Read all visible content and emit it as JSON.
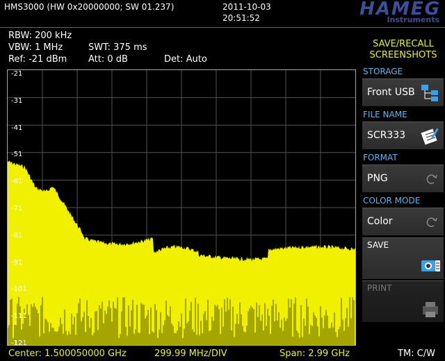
{
  "header": {
    "model": "HMS3000 (HW 0x20000000; SW 01.237)",
    "date": "2011-10-03",
    "time": "20:51:52",
    "logo_title": "HAMEG",
    "logo_sub": "Instruments"
  },
  "params": {
    "rbw": "RBW: 200 kHz",
    "vbw": "VBW: 1 MHz",
    "swt": "SWT: 375 ms",
    "ref": "Ref: -21 dBm",
    "att": "Att: 0 dB",
    "det": "Det: Auto"
  },
  "plot": {
    "y_labels": [
      "-21",
      "-31",
      "-41",
      "-51",
      "-61",
      "-71",
      "-81",
      "-91",
      "-101",
      "-111",
      "-121"
    ],
    "trace_color": "#f0f000",
    "grid_color": "#555555"
  },
  "footer": {
    "center": "Center: 1.500050000 GHz",
    "div": "299.99 MHz/DIV",
    "span": "Span: 2.99 GHz",
    "tm": "TM: C/W"
  },
  "menu": {
    "title_line1": "SAVE/RECALL",
    "title_line2": "SCREENSHOTS",
    "storage_label": "STORAGE",
    "storage_value": "Front USB",
    "filename_label": "FILE NAME",
    "filename_value": "SCR333",
    "format_label": "FORMAT",
    "format_value": "PNG",
    "colormode_label": "COLOR MODE",
    "colormode_value": "Color",
    "save_label": "SAVE",
    "print_label": "PRINT"
  },
  "colors": {
    "accent_yellow": "#e9ef2a",
    "label_blue": "#5fb6f0",
    "brand_blue": "#3d4e9a"
  }
}
